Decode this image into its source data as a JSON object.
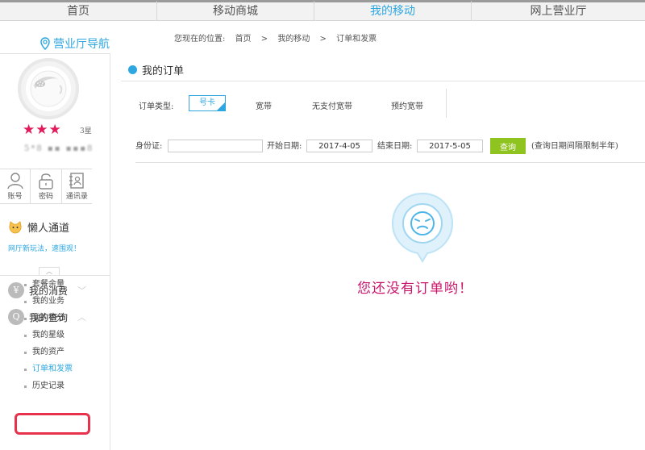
{
  "topnav": {
    "tabs": [
      "首页",
      "移动商城",
      "我的移动",
      "网上营业厅"
    ],
    "active_index": 2
  },
  "guide_label": "营业厅导航",
  "breadcrumb": {
    "prefix": "您现在的位置:",
    "items": [
      "首页",
      ">",
      "我的移动",
      ">",
      "订单和发票"
    ]
  },
  "profile": {
    "stars": "★★★",
    "star_level": "3星",
    "phone_masked": "5*8 ▪▪ ▪▪▪8"
  },
  "account_row": [
    "账号",
    "密码",
    "通讯录"
  ],
  "lazy": {
    "title": "懒人通道",
    "subtitle": "网厅新玩法，速围观！"
  },
  "menu": {
    "consumption": "我的消费",
    "query": "我的查询",
    "query_items": [
      "套餐余量",
      "我的业务",
      "我的积分",
      "我的星级",
      "我的资产",
      "订单和发票",
      "历史记录"
    ]
  },
  "main": {
    "title": "我的订单",
    "order_type_label": "订单类型:",
    "order_types": [
      "号卡",
      "宽带",
      "无支付宽带",
      "预约宽带"
    ],
    "id_label": "身份证:",
    "id_value": "",
    "start_label": "开始日期:",
    "start_date": "2017-4-05",
    "end_label": "结束日期:",
    "end_date": "2017-5-05",
    "query_button": "查询",
    "query_hint": "(查询日期间隔限制半年)",
    "empty_message": "您还没有订单哟！"
  },
  "colors": {
    "accent": "#2ea7e0",
    "empty_text": "#c9166b",
    "query_button": "#8fc31f",
    "highlight": "#e8314b",
    "stars": "#e3195a"
  }
}
